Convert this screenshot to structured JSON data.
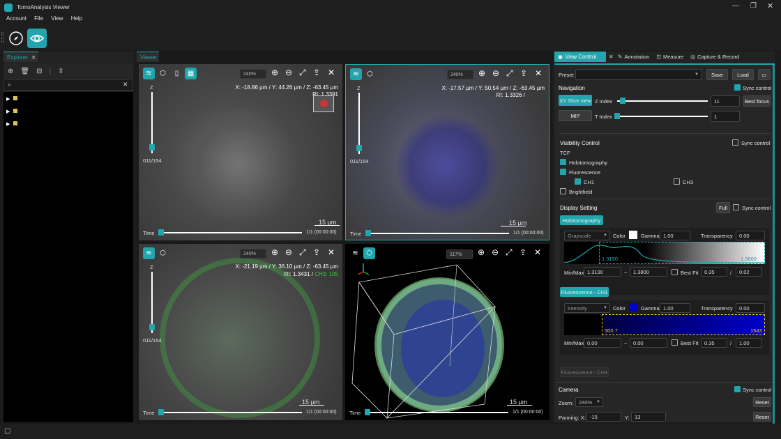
{
  "app": {
    "title": "TomoAnalysis Viewer"
  },
  "menu": [
    "Account",
    "File",
    "View",
    "Help"
  ],
  "explorer": {
    "tab": "Explorer"
  },
  "viewer": {
    "tab": "Viewer"
  },
  "views": [
    {
      "zoom": "240%",
      "xyz": "X: -18.86 µm / Y: 44.26 µm / Z: -63.45 µm",
      "ri": "RI: 1.3391",
      "z_label": "Z",
      "z_value": "011/154",
      "time": "Time",
      "time_value": "1/1 (00:00:00)",
      "scale": "15 µm",
      "z_level": 0.07
    },
    {
      "zoom": "240%",
      "xyz": "X: -17.57 µm / Y: 50.54 µm / Z: -63.45 µm",
      "ri": "RI: 1.3326 /",
      "z_label": "Z",
      "z_value": "011/154",
      "time": "Time",
      "time_value": "1/1 (00:00:00)",
      "scale": "15 µm",
      "z_level": 0.07
    },
    {
      "zoom": "240%",
      "xyz": "X: -21.19 µm / Y: 36.10 µm / Z: -63.45 µm",
      "ri": "RI: 1.3431 /",
      "ri_ch": "CH3: 105",
      "z_label": "Z",
      "z_value": "011/154",
      "time": "Time",
      "time_value": "1/1 (00:00:00)",
      "scale": "15 µm",
      "z_level": 0.07
    },
    {
      "zoom": "117%",
      "time": "Time",
      "time_value": "1/1 (00:00:00)",
      "scale": "15 µm"
    }
  ],
  "right": {
    "tabs": [
      "View Control",
      "Annotation",
      "Measure",
      "Capture & Record"
    ],
    "preset_label": "Preset",
    "save": "Save",
    "load": "Load",
    "navigation": "Navigation",
    "sync_control": "Sync control",
    "xy_slice": "XY Slice view",
    "mip": "MIP",
    "z_index_label": "Z Index",
    "z_index": "11",
    "t_index_label": "T Index",
    "t_index": "1",
    "best_focus": "Best focus",
    "visibility": "Visibility Control",
    "tcf": "TCF",
    "holo": "Holotomography",
    "fluor": "Fluorescence",
    "ch1": "CH1",
    "ch3": "CH3",
    "bright": "Brightfield",
    "display": "Display Setting",
    "full": "Full",
    "holo_btn": "Holotomography",
    "grayscale": "Grayscale",
    "color": "Color",
    "gamma": "Gamma",
    "gamma_v": "1.00",
    "transparency": "Transparency",
    "trans_v": "0.00",
    "holo_min_lbl": "1.3190",
    "holo_max_lbl": "1.3800",
    "minmax": "Min/Max",
    "holo_min": "1.3190",
    "holo_max": "1.3800",
    "tilde": "~",
    "bestfit": "Best Fit",
    "bf_a": "0.35",
    "slash": "/",
    "bf_b": "0.02",
    "fch1_btn": "Fluorescence - CH1",
    "intensity": "Intensity",
    "f_gamma_v": "1.00",
    "f_trans_v": "0.00",
    "f_lo": "300.7",
    "f_hi": "1543",
    "f_min": "0.00",
    "f_max": "0.00",
    "f_bf_a": "0.35",
    "f_bf_b": "1.00",
    "fch3_btn": "Fluorescence - CH3",
    "camera": "Camera",
    "zoom_label": "Zoom:",
    "zoom_v": "240%",
    "reset": "Reset",
    "panning": "Panning: X:",
    "pan_x": "-15",
    "pan_y_lbl": "Y:",
    "pan_y": "13"
  },
  "colors": {
    "accent": "#21a6ae",
    "ch1": "#0000c8"
  }
}
